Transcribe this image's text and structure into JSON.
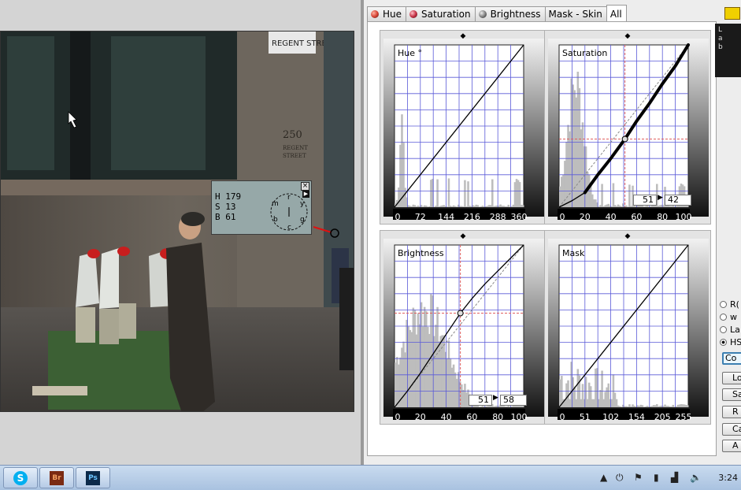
{
  "tabs": [
    {
      "label": "Hue",
      "icon": "hue-ball-icon",
      "color": "#d23c2d"
    },
    {
      "label": "Saturation",
      "icon": "saturation-ball-icon",
      "color": "#c0283c"
    },
    {
      "label": "Brightness",
      "icon": "brightness-ball-icon",
      "color": "#7a7a7a"
    },
    {
      "label": "Mask - Skin",
      "icon": "",
      "color": ""
    },
    {
      "label": "All",
      "icon": "",
      "color": ""
    }
  ],
  "active_tab": "All",
  "curves": {
    "hue": {
      "title": "Hue °",
      "ticks": [
        "0",
        "72",
        "144",
        "216",
        "288",
        "360"
      ]
    },
    "saturation": {
      "title": "Saturation",
      "ticks": [
        "0",
        "20",
        "40",
        "60",
        "80",
        "100"
      ],
      "input": "51",
      "output": "42"
    },
    "brightness": {
      "title": "Brightness",
      "ticks": [
        "0",
        "20",
        "40",
        "60",
        "80",
        "100"
      ],
      "input": "51",
      "output": "58"
    },
    "mask": {
      "title": "Mask",
      "ticks": [
        "0",
        "51",
        "102",
        "154",
        "205",
        "255"
      ]
    }
  },
  "info": {
    "h": "H  179",
    "s": "S   13",
    "b": "B   61",
    "wheel_letters": [
      "r",
      "y",
      "g",
      "c",
      "b",
      "m",
      "l"
    ]
  },
  "side": {
    "lab": [
      "L",
      "a",
      "b"
    ],
    "radios": [
      {
        "label": "R(",
        "on": false
      },
      {
        "label": "w",
        "on": false
      },
      {
        "label": "La",
        "on": false
      },
      {
        "label": "HS",
        "on": true
      }
    ],
    "buttons": [
      "Co",
      "Lo",
      "Sa",
      "R",
      "Ca",
      "A"
    ]
  },
  "taskbar": {
    "apps": [
      {
        "name": "skype-icon",
        "label": "S"
      },
      {
        "name": "bridge-icon",
        "label": "Br"
      },
      {
        "name": "photoshop-icon",
        "label": "Ps"
      }
    ],
    "clock": "3:24"
  },
  "colors": {
    "grid": "#5a5ad8",
    "guide": "#e06060"
  }
}
